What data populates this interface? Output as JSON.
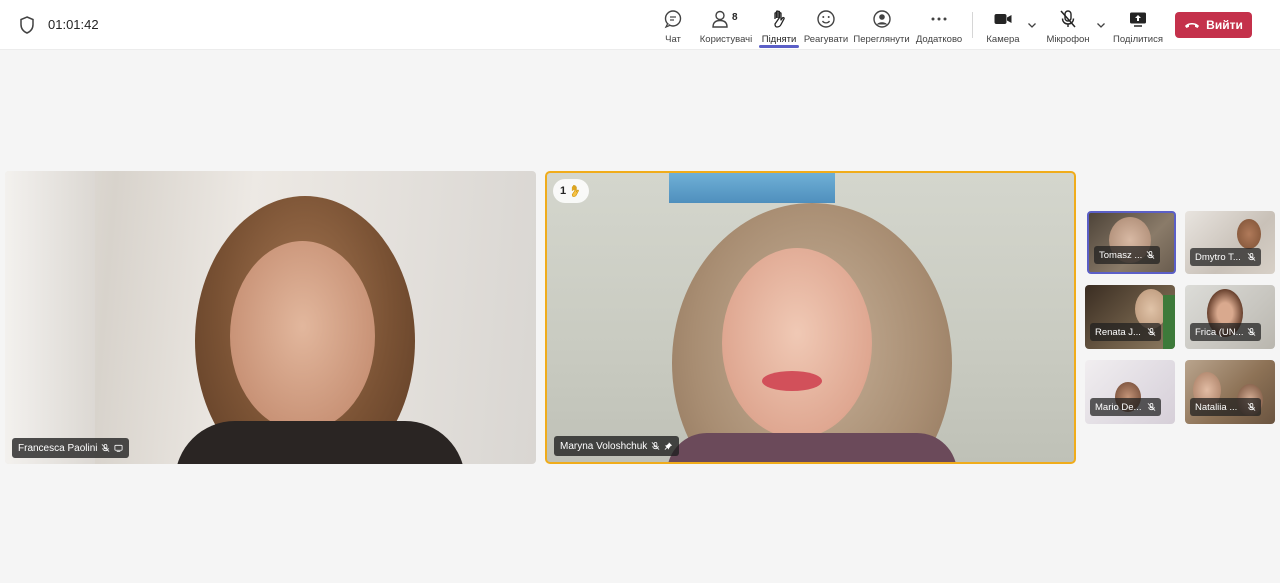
{
  "header": {
    "timer": "01:01:42",
    "participant_count": "8",
    "buttons": {
      "chat": "Чат",
      "people": "Користувачі",
      "raise": "Підняти",
      "react": "Реагувати",
      "view": "Переглянути",
      "more": "Додатково",
      "camera": "Камера",
      "mic": "Мікрофон",
      "share": "Поділитися",
      "leave": "Вийти"
    }
  },
  "stage": {
    "main_left": {
      "name": "Francesca Paolini"
    },
    "main_right": {
      "name": "Maryna Voloshchuk",
      "raised_hand_count": "1"
    }
  },
  "gallery": [
    {
      "name": "Tomasz ..."
    },
    {
      "name": "Dmytro T..."
    },
    {
      "name": "Renata J..."
    },
    {
      "name": "Frica (UN..."
    },
    {
      "name": "Mario De..."
    },
    {
      "name": "Nataliia ..."
    }
  ],
  "colors": {
    "leave": "#c4314b",
    "accent": "#5b5fc7",
    "speaker_border": "#f0ac1b"
  }
}
